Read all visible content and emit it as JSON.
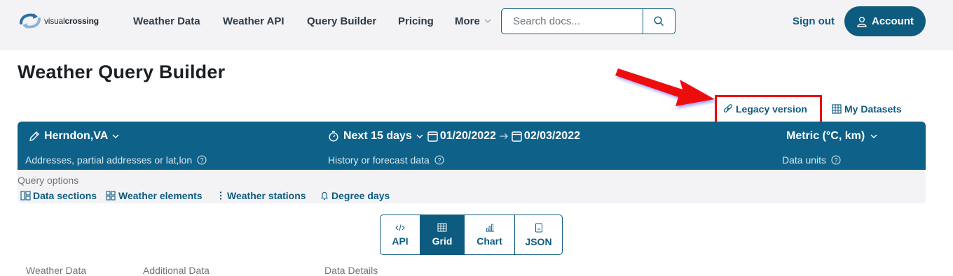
{
  "brand": {
    "name_light": "visual",
    "name_bold": "crossing"
  },
  "nav": {
    "links": [
      "Weather Data",
      "Weather API",
      "Query Builder",
      "Pricing",
      "More"
    ],
    "search_placeholder": "Search docs...",
    "signout": "Sign out",
    "account": "Account"
  },
  "page": {
    "title": "Weather Query Builder"
  },
  "links": {
    "legacy": "Legacy version",
    "datasets": "My Datasets"
  },
  "query": {
    "location": "Herndon,VA",
    "location_hint": "Addresses, partial addresses or lat,lon",
    "range": "Next 15 days",
    "start_date": "01/20/2022",
    "end_date": "02/03/2022",
    "range_hint": "History or forecast data",
    "units": "Metric (°C, km)",
    "units_hint": "Data units"
  },
  "options": {
    "label": "Query options",
    "items": [
      "Data sections",
      "Weather elements",
      "Weather stations",
      "Degree days"
    ]
  },
  "tabs": {
    "items": [
      "API",
      "Grid",
      "Chart",
      "JSON"
    ],
    "active": "Grid"
  },
  "sections": {
    "items": [
      "Weather Data",
      "Additional Data",
      "Data Details"
    ]
  },
  "colors": {
    "primary": "#0e5b80",
    "band": "#0e6189",
    "highlight": "#ee0000"
  }
}
